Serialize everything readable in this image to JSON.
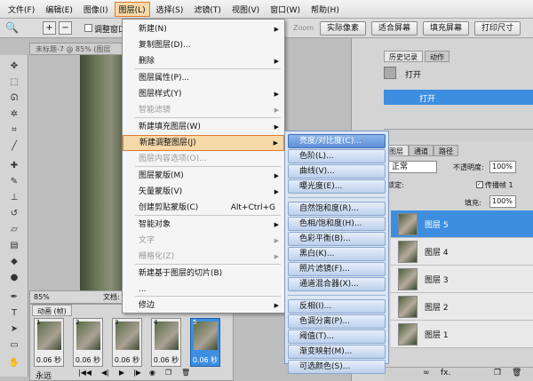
{
  "menubar": [
    "文件(F)",
    "编辑(E)",
    "图像(I)",
    "图层(L)",
    "选择(S)",
    "滤镜(T)",
    "视图(V)",
    "窗口(W)",
    "帮助(H)"
  ],
  "options": {
    "check_label": "调整窗口",
    "zoom_hint": "Zoom",
    "b1": "实际像素",
    "b2": "适合屏幕",
    "b3": "填充屏幕",
    "b4": "打印尺寸"
  },
  "document": {
    "tab": "未标题-7 @ 85% (图层",
    "zoom": "85%",
    "doc_label": "文档:"
  },
  "animation": {
    "title": "动画 (帧)",
    "frames": [
      {
        "n": "1",
        "t": "0.06 秒"
      },
      {
        "n": "2",
        "t": "0.06 秒"
      },
      {
        "n": "3",
        "t": "0.06 秒"
      },
      {
        "n": "4",
        "t": "0.06 秒"
      },
      {
        "n": "5",
        "t": "0.06 秒"
      }
    ],
    "loop": "永远"
  },
  "layer_menu": {
    "items": [
      {
        "label": "新建(N)",
        "arrow": true
      },
      {
        "label": "复制图层(D)..."
      },
      {
        "label": "删除",
        "arrow": true
      },
      {
        "label": "图层属性(P)..."
      },
      {
        "label": "图层样式(Y)",
        "arrow": true
      },
      {
        "label": "智能滤镜",
        "arrow": true,
        "disabled": true
      },
      {
        "label": "新建填充图层(W)",
        "arrow": true
      },
      {
        "label": "新建调整图层(J)",
        "arrow": true,
        "highlight": true
      },
      {
        "label": "图层内容选项(O)...",
        "disabled": true
      },
      {
        "label": "图层蒙版(M)",
        "arrow": true
      },
      {
        "label": "矢量蒙版(V)",
        "arrow": true
      },
      {
        "label": "创建剪贴蒙版(C)",
        "shortcut": "Alt+Ctrl+G"
      },
      {
        "label": "智能对象",
        "arrow": true
      },
      {
        "label": "文字",
        "arrow": true,
        "disabled": true
      },
      {
        "label": "栅格化(Z)",
        "arrow": true,
        "disabled": true
      },
      {
        "label": "新建基于图层的切片(B)"
      },
      {
        "label": "..."
      },
      {
        "label": "修边",
        "arrow": true
      }
    ]
  },
  "adjust_submenu": {
    "groups": [
      [
        "亮度/对比度(C)...",
        "色阶(L)...",
        "曲线(V)...",
        "曝光度(E)..."
      ],
      [
        "自然饱和度(R)...",
        "色相/饱和度(H)...",
        "色彩平衡(B)...",
        "黑白(K)...",
        "照片滤镜(F)...",
        "通道混合器(X)..."
      ],
      [
        "反相(I)...",
        "色调分离(P)...",
        "阈值(T)...",
        "渐变映射(M)...",
        "可选颜色(S)..."
      ]
    ]
  },
  "panels": {
    "history_tab": "历史记录",
    "actions_tab": "动作",
    "history_items": [
      "打开",
      "打开"
    ],
    "layers_tabs": [
      "图层",
      "通道",
      "路径"
    ],
    "blend_mode": "正常",
    "opacity_label": "不透明度:",
    "opacity_value": "100%",
    "lock_label": "锁定:",
    "fill_label": "填充:",
    "fill_value": "100%",
    "propagate_label": "传播帧 1",
    "layers": [
      "图层 5",
      "图层 4",
      "图层 3",
      "图层 2",
      "图层 1"
    ]
  }
}
